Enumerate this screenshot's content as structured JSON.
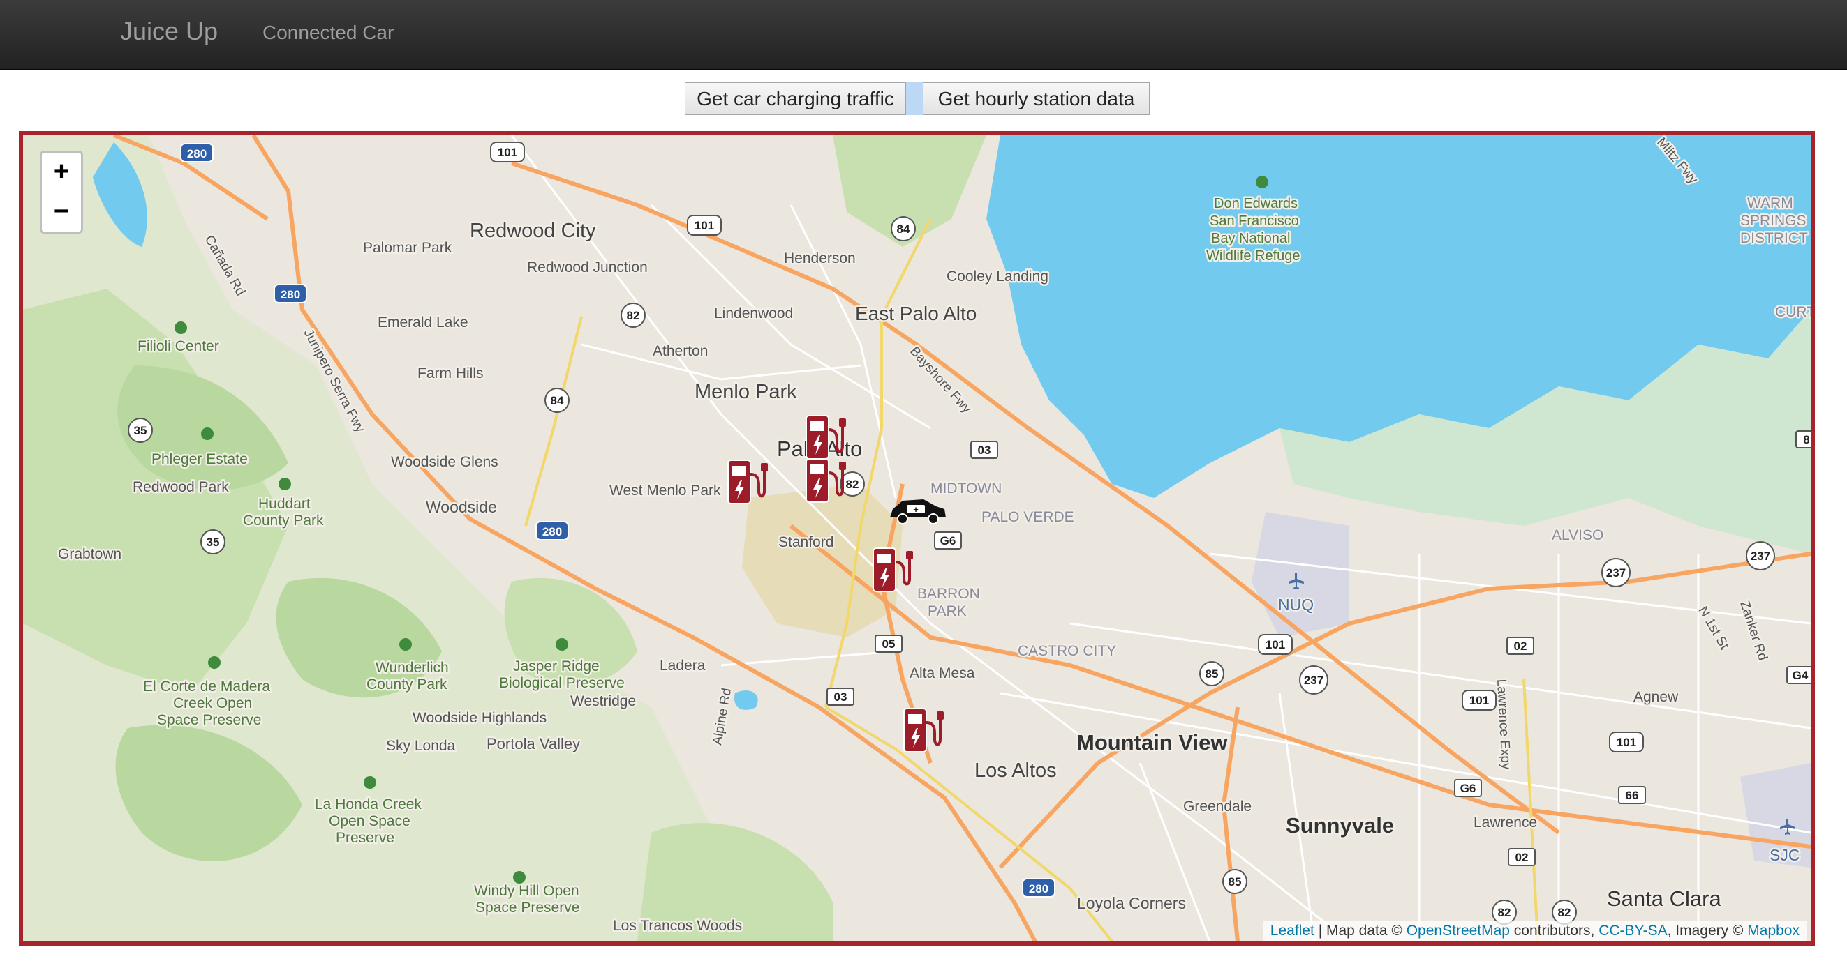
{
  "navbar": {
    "brand": "Juice Up",
    "link": "Connected Car"
  },
  "toolbar": {
    "traffic_button": "Get car charging traffic",
    "hourly_button": "Get hourly station data"
  },
  "map": {
    "zoom_in": "+",
    "zoom_out": "−",
    "attribution": {
      "leaflet": "Leaflet",
      "sep1": " | Map data © ",
      "osm": "OpenStreetMap",
      "sep2": " contributors, ",
      "license": "CC-BY-SA",
      "sep3": ", Imagery © ",
      "mapbox": "Mapbox"
    },
    "colors": {
      "water": "#72cbef",
      "park": "#c8e0b0",
      "land": "#ebe6de",
      "highway": "#f7a560",
      "marker": "#9c1c29",
      "frame": "#a8242c"
    },
    "labels": {
      "redwood_city": "Redwood City",
      "palomar_park": "Palomar Park",
      "redwood_junction": "Redwood Junction",
      "emerald_lake": "Emerald Lake",
      "filioli": "Filioli Center",
      "farm_hills": "Farm Hills",
      "henderson": "Henderson",
      "cooley_landing": "Cooley Landing",
      "lindenwood": "Lindenwood",
      "east_palo_alto": "East Palo Alto",
      "atherton": "Atherton",
      "menlo_park": "Menlo Park",
      "palo_alto": "Palo Alto",
      "woodside_glens": "Woodside Glens",
      "woodside": "Woodside",
      "west_menlo_park": "West Menlo Park",
      "phleger_estate": "Phleger Estate",
      "redwood_park": "Redwood Park",
      "huddart_1": "Huddart",
      "huddart_2": "County Park",
      "grabtown": "Grabtown",
      "midtown": "MIDTOWN",
      "palo_verde": "PALO VERDE",
      "stanford": "Stanford",
      "barron_park_1": "BARRON",
      "barron_park_2": "PARK",
      "castro_city": "CASTRO CITY",
      "alta_mesa": "Alta Mesa",
      "ladera": "Ladera",
      "westridge": "Westridge",
      "wunderlich_1": "Wunderlich",
      "wunderlich_2": "County Park",
      "jasper_1": "Jasper Ridge",
      "jasper_2": "Biological Preserve",
      "el_corte_1": "El Corte de Madera",
      "el_corte_2": "Creek Open",
      "el_corte_3": "Space Preserve",
      "woodside_highlands": "Woodside Highlands",
      "sky_londa": "Sky Londa",
      "portola_valley": "Portola Valley",
      "la_honda_1": "La Honda Creek",
      "la_honda_2": "Open Space",
      "la_honda_3": "Preserve",
      "windy_hill_1": "Windy Hill Open",
      "windy_hill_2": "Space Preserve",
      "los_trancos": "Los Trancos Woods",
      "mountain_view": "Mountain View",
      "los_altos": "Los Altos",
      "greendale": "Greendale",
      "sunnyvale": "Sunnyvale",
      "lawrence": "Lawrence",
      "loyola_corners": "Loyola Corners",
      "santa_clara": "Santa Clara",
      "agnew": "Agnew",
      "alviso": "ALVISO",
      "nuq": "NUQ",
      "sjc": "SJC",
      "warm_1": "WARM",
      "warm_2": "SPRINGS",
      "warm_3": "DISTRICT",
      "curt": "CURT",
      "don_1": "Don Edwards",
      "don_2": "San Francisco",
      "don_3": "Bay National",
      "don_4": "Wildlife Refuge",
      "canada_rd": "Cañada Rd",
      "junipero": "Junipero Serra Fwy",
      "bayshore": "Bayshore Fwy",
      "alpine_rd": "Alpine Rd",
      "lawrence_expy": "Lawrence Expy",
      "n1st": "N 1st St",
      "zanker": "Zanker Rd",
      "mlitz": "Mlitz Fwy"
    },
    "shields": {
      "s280a": "280",
      "s280b": "280",
      "s280c": "280",
      "s280d": "280",
      "s101a": "101",
      "s101b": "101",
      "s101c": "101",
      "s101d": "101",
      "s101e": "101",
      "s84a": "84",
      "s84b": "84",
      "s82a": "82",
      "s82b": "82",
      "s82c": "82",
      "s82d": "82",
      "s35a": "35",
      "s35b": "35",
      "s237a": "237",
      "s237b": "237",
      "s237c": "237",
      "s85a": "85",
      "s85b": "85",
      "s03a": "03",
      "s03b": "03",
      "sG6a": "G6",
      "sG6b": "G6",
      "s05": "05",
      "s02a": "02",
      "s02b": "02",
      "s66": "66",
      "sG4": "G4",
      "s8": "8"
    },
    "markers": [
      {
        "type": "charging-station"
      },
      {
        "type": "charging-station"
      },
      {
        "type": "charging-station"
      },
      {
        "type": "charging-station"
      },
      {
        "type": "charging-station"
      },
      {
        "type": "car"
      }
    ]
  }
}
